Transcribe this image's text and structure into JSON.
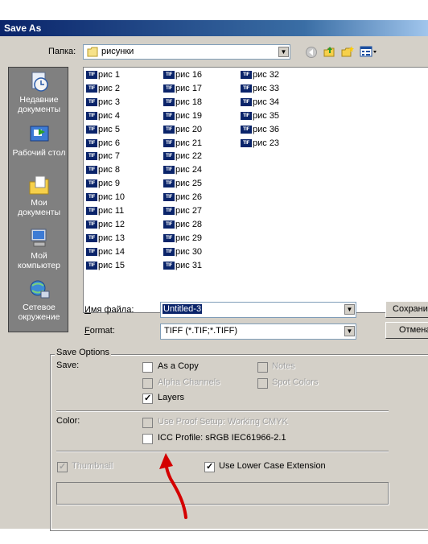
{
  "window": {
    "title": "Save As"
  },
  "header": {
    "folder_label": "Папка:",
    "folder_value": "рисунки"
  },
  "places": [
    {
      "label_line1": "Недавние",
      "label_line2": "документы",
      "icon": "recent-documents-icon"
    },
    {
      "label_line1": "Рабочий стол",
      "label_line2": "",
      "icon": "desktop-icon"
    },
    {
      "label_line1": "Мои",
      "label_line2": "документы",
      "icon": "my-documents-icon"
    },
    {
      "label_line1": "Мой",
      "label_line2": "компьютер",
      "icon": "my-computer-icon"
    },
    {
      "label_line1": "Сетевое",
      "label_line2": "окружение",
      "icon": "network-places-icon"
    }
  ],
  "files": {
    "col1": [
      "рис 1",
      "рис 2",
      "рис 3",
      "рис 4",
      "рис 5",
      "рис 6",
      "рис 7",
      "рис 8",
      "рис 9",
      "рис 10",
      "рис 11",
      "рис 12",
      "рис 13",
      "рис 14",
      "рис 15"
    ],
    "col2": [
      "рис 16",
      "рис 17",
      "рис 18",
      "рис 19",
      "рис 20",
      "рис 21",
      "рис 22",
      "рис 24",
      "рис 25",
      "рис 26",
      "рис 27",
      "рис 28",
      "рис 29",
      "рис 30",
      "рис 31"
    ],
    "col3": [
      "рис 32",
      "рис 33",
      "рис 34",
      "рис 35",
      "рис 36",
      "рис  23"
    ],
    "file_badge": "TIF"
  },
  "filename": {
    "label": "Имя файла:",
    "value": "Untitled-3"
  },
  "format": {
    "label": "Format:",
    "value": "TIFF (*.TIF;*.TIFF)"
  },
  "buttons": {
    "save": "Сохрани",
    "cancel": "Отмена"
  },
  "save_options": {
    "title": "Save Options",
    "save_label": "Save:",
    "as_copy": "As a Copy",
    "notes": "Notes",
    "alpha_channels": "Alpha Channels",
    "spot_colors": "Spot Colors",
    "layers": "Layers",
    "color_label": "Color:",
    "use_proof_setup": "Use Proof Setup:  Working CMYK",
    "icc_profile": "ICC Profile:  sRGB IEC61966-2.1",
    "thumbnail": "Thumbnail",
    "lower_case_ext": "Use Lower Case Extension",
    "checked": {
      "as_copy": false,
      "notes": false,
      "alpha_channels": false,
      "spot_colors": false,
      "layers": true,
      "use_proof_setup": false,
      "icc_profile": false,
      "thumbnail": true,
      "lower_case_ext": true
    }
  },
  "colors": {
    "title_bar": "#0a246a",
    "dialog_bg": "#d4d0c8",
    "annotation_arrow": "#d40000"
  }
}
